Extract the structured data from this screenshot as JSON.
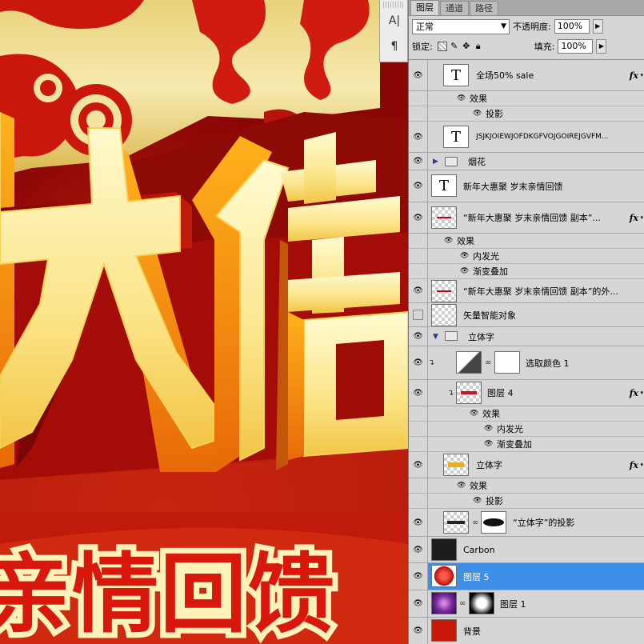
{
  "panel": {
    "tabs": [
      {
        "label": "图层",
        "active": true
      },
      {
        "label": "通道",
        "active": false
      },
      {
        "label": "路径",
        "active": false
      }
    ],
    "blend_mode": "正常",
    "opacity_label": "不透明度:",
    "opacity_value": "100%",
    "lock_label": "锁定:",
    "fill_label": "填充:",
    "fill_value": "100%"
  },
  "mini_toolbar": {
    "tool1": "A|",
    "tool2": "¶"
  },
  "layers": {
    "l1": {
      "name": "全场50% sale",
      "fx": "fx"
    },
    "l1_effects": "效果",
    "l1_shadow": "投影",
    "l2": {
      "name": "JSJKJOIEWJOFDKGFVOJGOIREJGVFM..."
    },
    "l3": {
      "name": "烟花"
    },
    "l4": {
      "name": "新年大惠聚  岁末亲情回馈"
    },
    "l5": {
      "name": "“新年大惠聚  岁末亲情回馈 副本”...",
      "fx": "fx"
    },
    "l5_effects": "效果",
    "l5_inner_glow": "内发光",
    "l5_gradient": "渐变叠加",
    "l6": {
      "name": "“新年大惠聚  岁末亲情回馈 副本”的外..."
    },
    "l7": {
      "name": "矢量智能对象"
    },
    "l8": {
      "name": "立体字"
    },
    "l9": {
      "name": "选取颜色 1"
    },
    "l10": {
      "name": "图层 4",
      "fx": "fx"
    },
    "l10_effects": "效果",
    "l10_inner_glow": "内发光",
    "l10_gradient": "渐变叠加",
    "l11": {
      "name": "立体字",
      "fx": "fx"
    },
    "l11_effects": "效果",
    "l11_shadow": "投影",
    "l12": {
      "name": "“立体字”的投影"
    },
    "l13": {
      "name": "Carbon"
    },
    "l14": {
      "name": "图层 5"
    },
    "l15": {
      "name": "图层 1"
    },
    "l16": {
      "name": "背景"
    }
  },
  "canvas": {
    "slogan": "亲情回馈"
  },
  "colors": {
    "selection": "#3d8fe8",
    "panel_bg": "#d6d6d6",
    "canvas_red": "#b80e08",
    "gold": "#f5d566"
  }
}
